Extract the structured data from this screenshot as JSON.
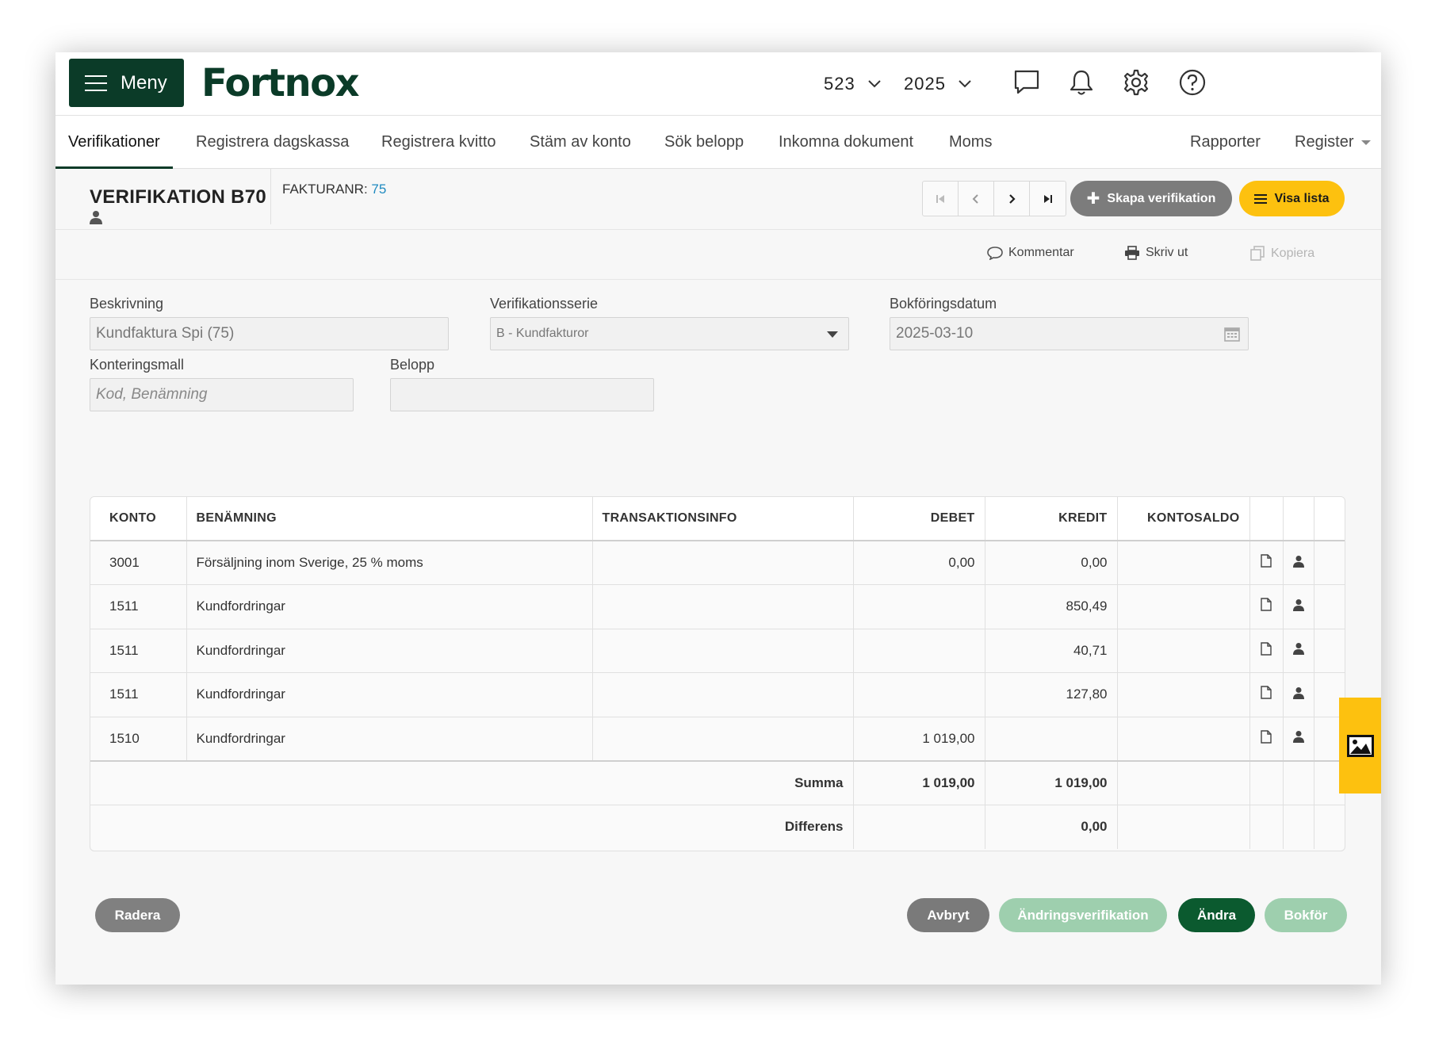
{
  "header": {
    "menu_label": "Meny",
    "logo_text": "Fortnox",
    "company_selector": "523",
    "year_selector": "2025"
  },
  "nav": {
    "tabs": [
      {
        "label": "Verifikationer",
        "active": true
      },
      {
        "label": "Registrera dagskassa"
      },
      {
        "label": "Registrera kvitto"
      },
      {
        "label": "Stäm av konto"
      },
      {
        "label": "Sök belopp"
      },
      {
        "label": "Inkomna dokument"
      },
      {
        "label": "Moms"
      }
    ],
    "right": [
      {
        "label": "Rapporter"
      },
      {
        "label": "Register"
      }
    ]
  },
  "voucher": {
    "title": "VERIFIKATION B70",
    "invoice_label": "FAKTURANR:",
    "invoice_number": "75",
    "create_button": "Skapa verifikation",
    "list_button": "Visa lista"
  },
  "actions": {
    "comment": "Kommentar",
    "print": "Skriv ut",
    "copy": "Kopiera"
  },
  "form": {
    "description": {
      "label": "Beskrivning",
      "value": "Kundfaktura Spi (75)"
    },
    "series": {
      "label": "Verifikationsserie",
      "value": "B - Kundfakturor"
    },
    "date": {
      "label": "Bokföringsdatum",
      "value": "2025-03-10"
    },
    "template": {
      "label": "Konteringsmall",
      "placeholder": "Kod, Benämning"
    },
    "amount": {
      "label": "Belopp",
      "value": ""
    }
  },
  "table": {
    "headers": {
      "konto": "KONTO",
      "benamning": "BENÄMNING",
      "transaktionsinfo": "TRANSAKTIONSINFO",
      "debet": "DEBET",
      "kredit": "KREDIT",
      "kontosaldo": "KONTOSALDO"
    },
    "rows": [
      {
        "konto": "3001",
        "benamning": "Försäljning inom Sverige, 25 % moms",
        "transaktionsinfo": "",
        "debet": "0,00",
        "kredit": "0,00",
        "kontosaldo": ""
      },
      {
        "konto": "1511",
        "benamning": "Kundfordringar",
        "transaktionsinfo": "",
        "debet": "",
        "kredit": "850,49",
        "kontosaldo": ""
      },
      {
        "konto": "1511",
        "benamning": "Kundfordringar",
        "transaktionsinfo": "",
        "debet": "",
        "kredit": "40,71",
        "kontosaldo": ""
      },
      {
        "konto": "1511",
        "benamning": "Kundfordringar",
        "transaktionsinfo": "",
        "debet": "",
        "kredit": "127,80",
        "kontosaldo": ""
      },
      {
        "konto": "1510",
        "benamning": "Kundfordringar",
        "transaktionsinfo": "",
        "debet": "1 019,00",
        "kredit": "",
        "kontosaldo": ""
      }
    ],
    "sum_label": "Summa",
    "sum_debet": "1 019,00",
    "sum_kredit": "1 019,00",
    "diff_label": "Differens",
    "diff_value": "0,00"
  },
  "buttons": {
    "delete": "Radera",
    "cancel": "Avbryt",
    "change_voucher": "Ändringsverifikation",
    "edit": "Ändra",
    "book": "Bokför"
  },
  "colors": {
    "brand_green": "#0b3b28",
    "accent_yellow": "#fdc10f",
    "link_blue": "#1f8ac0",
    "button_gray": "#7c7c7c",
    "disabled_green": "#9ecfae",
    "edit_green": "#0b5a2f"
  },
  "icons": {
    "header": [
      "chat-icon",
      "bell-icon",
      "gear-icon",
      "help-icon"
    ],
    "row": [
      "document-icon",
      "user-icon"
    ],
    "side": "image-icon"
  }
}
